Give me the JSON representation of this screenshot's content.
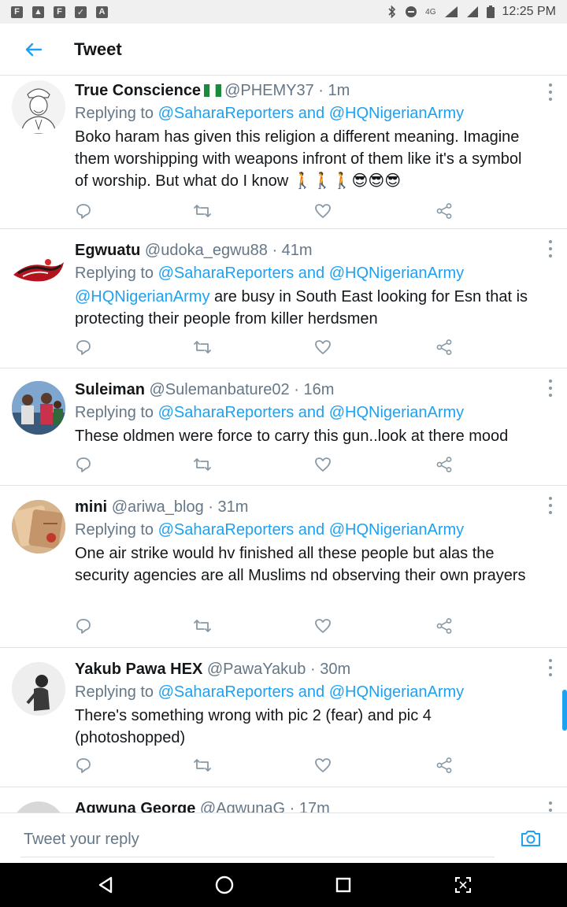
{
  "status_bar": {
    "left_icons": [
      "F",
      "▲",
      "F",
      "✓",
      "A"
    ],
    "network": "4G",
    "time": "12:25 PM"
  },
  "header": {
    "title": "Tweet"
  },
  "tweets": [
    {
      "name": "True Conscience",
      "emoji": "🇳🇬",
      "handle": "@PHEMY37",
      "time": "· 1m",
      "reply_prefix": "Replying to",
      "reply_to_1": "@SaharaReporters",
      "reply_and": "and",
      "reply_to_2": "@HQNigerianArmy",
      "body": "Boko haram has given this religion a different meaning. Imagine them worshipping with weapons infront of them like it's a symbol of worship. But what do I know 🚶🚶🚶😎😎😎",
      "body_mention": ""
    },
    {
      "name": "Egwuatu",
      "handle": "@udoka_egwu88",
      "time": "· 41m",
      "reply_prefix": "Replying to",
      "reply_to_1": "@SaharaReporters",
      "reply_and": "and",
      "reply_to_2": "@HQNigerianArmy",
      "body_mention": "@HQNigerianArmy",
      "body": " are busy in South East looking for Esn that is protecting their people from killer herdsmen"
    },
    {
      "name": "Suleiman",
      "handle": "@Sulemanbature02",
      "time": "· 16m",
      "reply_prefix": "Replying to",
      "reply_to_1": "@SaharaReporters",
      "reply_and": "and",
      "reply_to_2": "@HQNigerianArmy",
      "body_mention": "",
      "body": "These oldmen were force to carry this gun..look at there mood"
    },
    {
      "name": "mini",
      "handle": "@ariwa_blog",
      "time": "· 31m",
      "reply_prefix": "Replying to",
      "reply_to_1": "@SaharaReporters",
      "reply_and": "and",
      "reply_to_2": "@HQNigerianArmy",
      "body_mention": "",
      "body": "One air strike would hv finished all these people but alas the security agencies are all Muslims nd observing their own prayers"
    },
    {
      "name": "Yakub Pawa HEX",
      "handle": "@PawaYakub",
      "time": "· 30m",
      "reply_prefix": "Replying to",
      "reply_to_1": "@SaharaReporters",
      "reply_and": "and",
      "reply_to_2": "@HQNigerianArmy",
      "body_mention": "",
      "body": "There's something wrong with pic 2 (fear) and pic 4 (photoshopped)"
    },
    {
      "name": "Agwuna George",
      "handle": "@AgwunaG",
      "time": "· 17m"
    }
  ],
  "reply_bar": {
    "placeholder": "Tweet your reply"
  },
  "colors": {
    "accent": "#1da1f2",
    "secondary_text": "#657786",
    "icon_gray": "#8899a6"
  },
  "icons": {
    "back": "arrow-left-icon",
    "reply": "comment-icon",
    "retweet": "retweet-icon",
    "like": "heart-icon",
    "share": "share-icon",
    "camera": "camera-icon",
    "nav_back": "triangle-back-icon",
    "nav_home": "circle-home-icon",
    "nav_recents": "square-recents-icon",
    "nav_extra": "screenshot-icon"
  }
}
